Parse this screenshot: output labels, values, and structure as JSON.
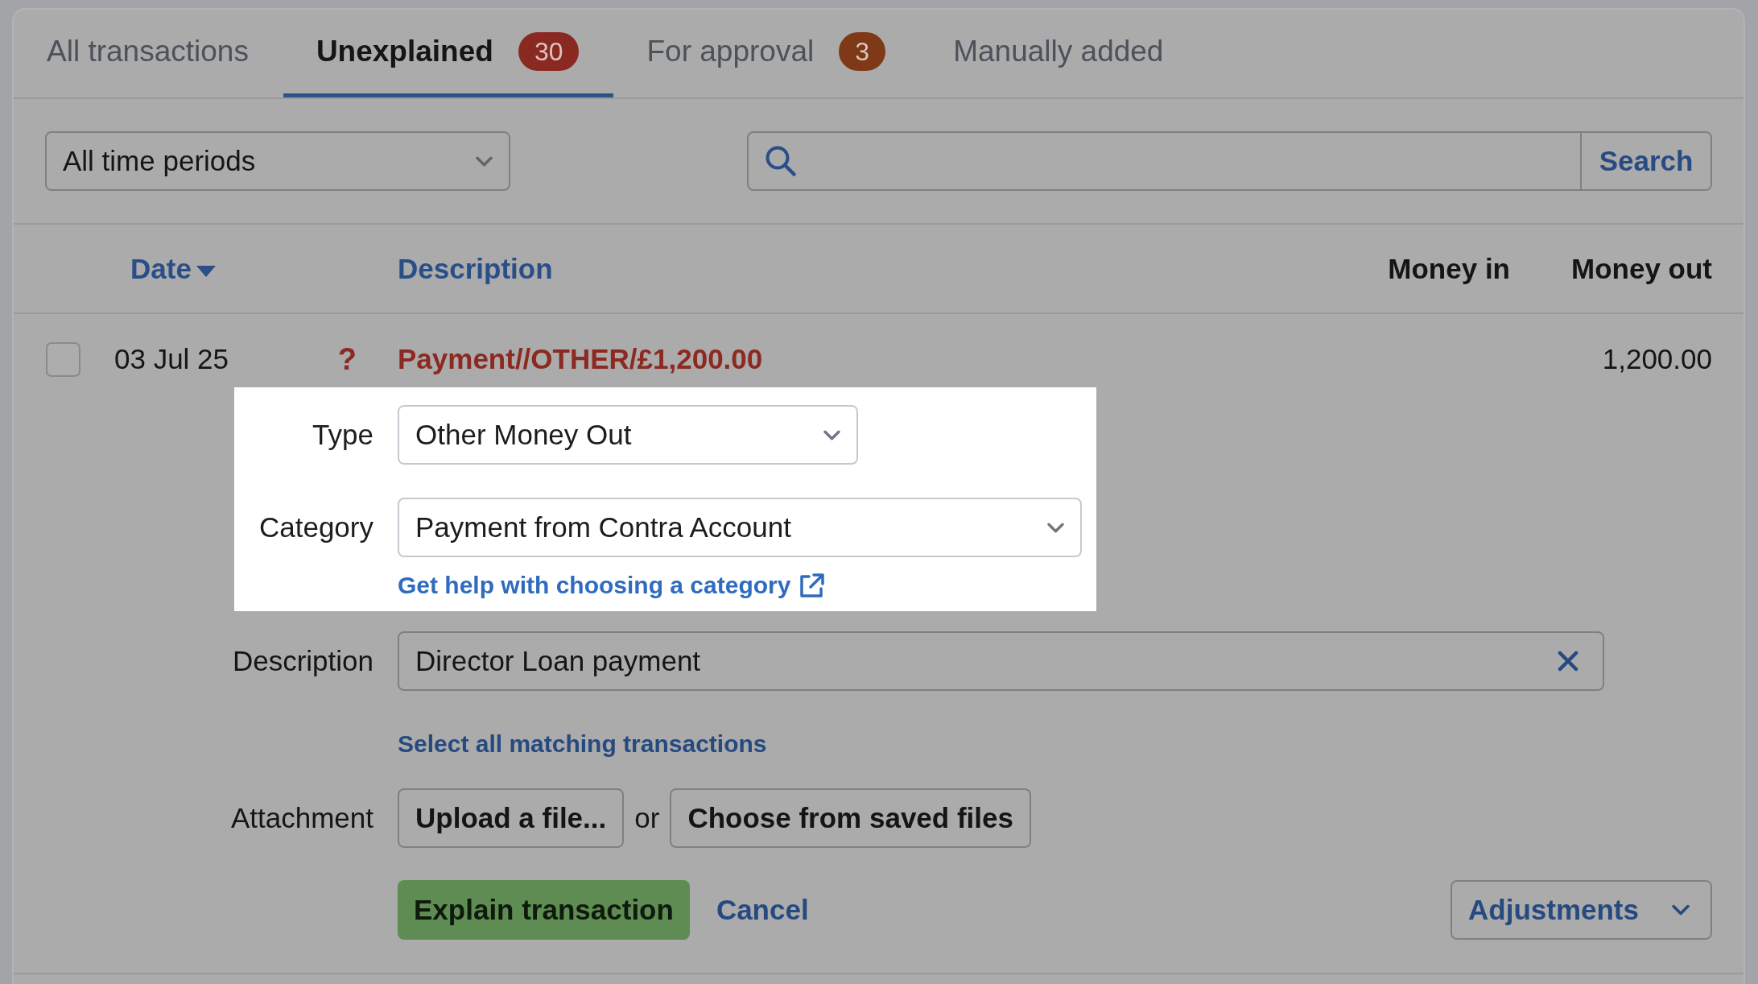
{
  "tabs": [
    {
      "label": "All transactions",
      "selected": false
    },
    {
      "label": "Unexplained",
      "selected": true,
      "badge": {
        "text": "30",
        "color": "#8a2822"
      }
    },
    {
      "label": "For approval",
      "selected": false,
      "badge": {
        "text": "3",
        "color": "#7e3a17"
      }
    },
    {
      "label": "Manually added",
      "selected": false
    }
  ],
  "filters": {
    "period": {
      "value": "All time periods"
    },
    "search": {
      "button": "Search"
    }
  },
  "table": {
    "columns": [
      {
        "label": "Date",
        "sortable": true,
        "sorted": true
      },
      {
        "label": "Description",
        "sortable": true
      },
      {
        "label": "Money in",
        "sortable": false
      },
      {
        "label": "Money out",
        "sortable": false
      }
    ],
    "rows": [
      {
        "selected": false,
        "date": "03 Jul 25",
        "status_mark": "?",
        "description": "Payment//OTHER/£1,200.00",
        "money_out": "1,200.00",
        "expanded": true,
        "form": {
          "groups": [
            {
              "highlighted": true,
              "fields": [
                {
                  "kind": "select",
                  "label": "Type",
                  "value": "Other Money Out"
                },
                {
                  "kind": "select",
                  "label": "Category",
                  "value": "Payment from Contra Account",
                  "link": {
                    "text": "Get help with choosing a category",
                    "external": true
                  }
                }
              ]
            },
            {
              "highlighted": false,
              "fields": [
                {
                  "kind": "text",
                  "label": "Description",
                  "value": "Director Loan payment",
                  "clearable": true,
                  "link": {
                    "text": "Select all matching transactions"
                  }
                },
                {
                  "kind": "attachment",
                  "label": "Attachment",
                  "buttons": [
                    "Upload a file...",
                    "Choose from saved files"
                  ],
                  "separator": "or"
                }
              ]
            }
          ],
          "actions": {
            "primary": "Explain transaction",
            "cancel": "Cancel",
            "menu": "Adjustments"
          }
        }
      }
    ]
  }
}
